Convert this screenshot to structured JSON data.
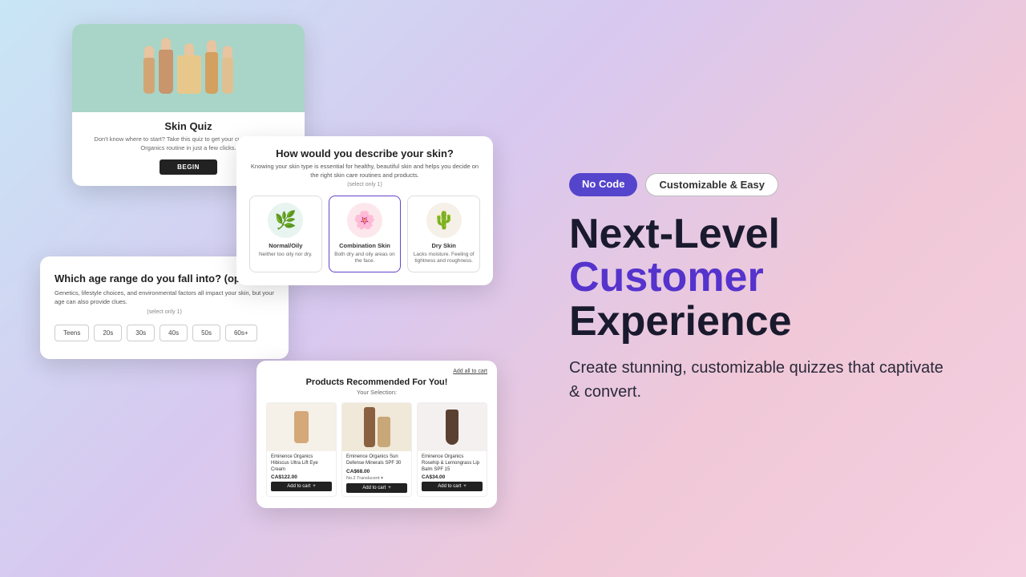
{
  "badges": {
    "nocode": "No Code",
    "custom": "Customizable & Easy"
  },
  "headline": {
    "line1": "Next-Level",
    "line2": "Customer",
    "line3": "Experience"
  },
  "description": "Create stunning, customizable quizzes that captivate & convert.",
  "card_skin_quiz": {
    "title": "Skin Quiz",
    "subtitle": "Don't know where to start? Take this quiz to get your custom Eminence Organics routine in just a few clicks.",
    "begin_btn": "BEGIN"
  },
  "card_skin_type": {
    "title": "How would you describe your skin?",
    "subtitle": "Knowing your skin type is essential for healthy, beautiful skin and helps you decide on the right skin care routines and products.",
    "select_note": "(select only 1)",
    "options": [
      {
        "name": "Normal/Oily",
        "desc": "Neither too oily nor dry.",
        "icon": "🌿"
      },
      {
        "name": "Combination Skin",
        "desc": "Both dry and oily areas on the face.",
        "icon": "🌸"
      },
      {
        "name": "Dry Skin",
        "desc": "Lacks moisture. Feeling of tightness and roughness.",
        "icon": "🌵"
      }
    ]
  },
  "card_age": {
    "title": "Which age range do you fall into? (optional)",
    "subtitle": "Genetics, lifestyle choices, and environmental factors all impact your skin, but your age can also provide clues.",
    "select_note": "(select only 1)",
    "options": [
      "Teens",
      "20s",
      "30s",
      "40s",
      "50s",
      "60s+"
    ]
  },
  "card_products": {
    "add_all": "Add all to cart",
    "title": "Products Recommended For You!",
    "subtitle": "Your Selection:",
    "products": [
      {
        "name": "Eminence Organics Hibiscus Ultra Lift Eye Cream",
        "price": "CA$122.00",
        "select": ""
      },
      {
        "name": "Eminence Organics Sun Defense Minerals SPF 30",
        "price": "CA$68.00",
        "select": "No.2 Translucent"
      },
      {
        "name": "Eminence Organics Rosehip & Lemongrass Lip Balm SPF 15",
        "price": "CA$34.00",
        "select": ""
      }
    ],
    "add_cart_label": "Add to cart"
  }
}
